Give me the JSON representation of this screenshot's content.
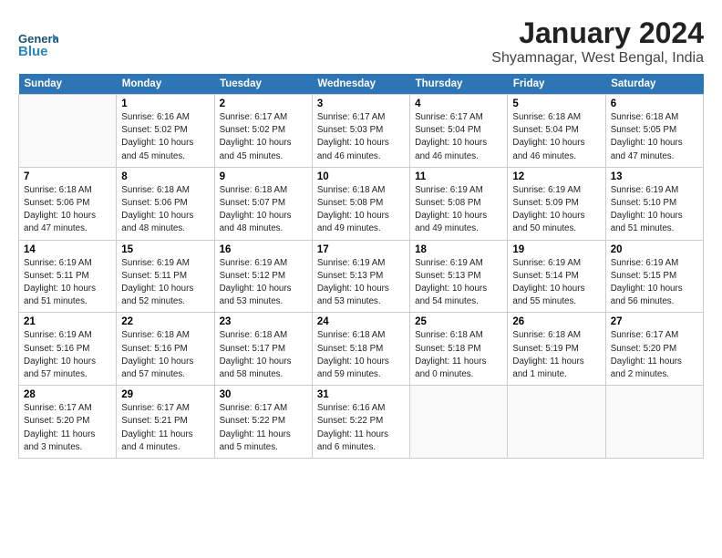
{
  "logo": {
    "general": "General",
    "blue": "Blue"
  },
  "title": "January 2024",
  "subtitle": "Shyamnagar, West Bengal, India",
  "days_header": [
    "Sunday",
    "Monday",
    "Tuesday",
    "Wednesday",
    "Thursday",
    "Friday",
    "Saturday"
  ],
  "weeks": [
    [
      {
        "num": "",
        "info": ""
      },
      {
        "num": "1",
        "info": "Sunrise: 6:16 AM\nSunset: 5:02 PM\nDaylight: 10 hours\nand 45 minutes."
      },
      {
        "num": "2",
        "info": "Sunrise: 6:17 AM\nSunset: 5:02 PM\nDaylight: 10 hours\nand 45 minutes."
      },
      {
        "num": "3",
        "info": "Sunrise: 6:17 AM\nSunset: 5:03 PM\nDaylight: 10 hours\nand 46 minutes."
      },
      {
        "num": "4",
        "info": "Sunrise: 6:17 AM\nSunset: 5:04 PM\nDaylight: 10 hours\nand 46 minutes."
      },
      {
        "num": "5",
        "info": "Sunrise: 6:18 AM\nSunset: 5:04 PM\nDaylight: 10 hours\nand 46 minutes."
      },
      {
        "num": "6",
        "info": "Sunrise: 6:18 AM\nSunset: 5:05 PM\nDaylight: 10 hours\nand 47 minutes."
      }
    ],
    [
      {
        "num": "7",
        "info": "Sunrise: 6:18 AM\nSunset: 5:06 PM\nDaylight: 10 hours\nand 47 minutes."
      },
      {
        "num": "8",
        "info": "Sunrise: 6:18 AM\nSunset: 5:06 PM\nDaylight: 10 hours\nand 48 minutes."
      },
      {
        "num": "9",
        "info": "Sunrise: 6:18 AM\nSunset: 5:07 PM\nDaylight: 10 hours\nand 48 minutes."
      },
      {
        "num": "10",
        "info": "Sunrise: 6:18 AM\nSunset: 5:08 PM\nDaylight: 10 hours\nand 49 minutes."
      },
      {
        "num": "11",
        "info": "Sunrise: 6:19 AM\nSunset: 5:08 PM\nDaylight: 10 hours\nand 49 minutes."
      },
      {
        "num": "12",
        "info": "Sunrise: 6:19 AM\nSunset: 5:09 PM\nDaylight: 10 hours\nand 50 minutes."
      },
      {
        "num": "13",
        "info": "Sunrise: 6:19 AM\nSunset: 5:10 PM\nDaylight: 10 hours\nand 51 minutes."
      }
    ],
    [
      {
        "num": "14",
        "info": "Sunrise: 6:19 AM\nSunset: 5:11 PM\nDaylight: 10 hours\nand 51 minutes."
      },
      {
        "num": "15",
        "info": "Sunrise: 6:19 AM\nSunset: 5:11 PM\nDaylight: 10 hours\nand 52 minutes."
      },
      {
        "num": "16",
        "info": "Sunrise: 6:19 AM\nSunset: 5:12 PM\nDaylight: 10 hours\nand 53 minutes."
      },
      {
        "num": "17",
        "info": "Sunrise: 6:19 AM\nSunset: 5:13 PM\nDaylight: 10 hours\nand 53 minutes."
      },
      {
        "num": "18",
        "info": "Sunrise: 6:19 AM\nSunset: 5:13 PM\nDaylight: 10 hours\nand 54 minutes."
      },
      {
        "num": "19",
        "info": "Sunrise: 6:19 AM\nSunset: 5:14 PM\nDaylight: 10 hours\nand 55 minutes."
      },
      {
        "num": "20",
        "info": "Sunrise: 6:19 AM\nSunset: 5:15 PM\nDaylight: 10 hours\nand 56 minutes."
      }
    ],
    [
      {
        "num": "21",
        "info": "Sunrise: 6:19 AM\nSunset: 5:16 PM\nDaylight: 10 hours\nand 57 minutes."
      },
      {
        "num": "22",
        "info": "Sunrise: 6:18 AM\nSunset: 5:16 PM\nDaylight: 10 hours\nand 57 minutes."
      },
      {
        "num": "23",
        "info": "Sunrise: 6:18 AM\nSunset: 5:17 PM\nDaylight: 10 hours\nand 58 minutes."
      },
      {
        "num": "24",
        "info": "Sunrise: 6:18 AM\nSunset: 5:18 PM\nDaylight: 10 hours\nand 59 minutes."
      },
      {
        "num": "25",
        "info": "Sunrise: 6:18 AM\nSunset: 5:18 PM\nDaylight: 11 hours\nand 0 minutes."
      },
      {
        "num": "26",
        "info": "Sunrise: 6:18 AM\nSunset: 5:19 PM\nDaylight: 11 hours\nand 1 minute."
      },
      {
        "num": "27",
        "info": "Sunrise: 6:17 AM\nSunset: 5:20 PM\nDaylight: 11 hours\nand 2 minutes."
      }
    ],
    [
      {
        "num": "28",
        "info": "Sunrise: 6:17 AM\nSunset: 5:20 PM\nDaylight: 11 hours\nand 3 minutes."
      },
      {
        "num": "29",
        "info": "Sunrise: 6:17 AM\nSunset: 5:21 PM\nDaylight: 11 hours\nand 4 minutes."
      },
      {
        "num": "30",
        "info": "Sunrise: 6:17 AM\nSunset: 5:22 PM\nDaylight: 11 hours\nand 5 minutes."
      },
      {
        "num": "31",
        "info": "Sunrise: 6:16 AM\nSunset: 5:22 PM\nDaylight: 11 hours\nand 6 minutes."
      },
      {
        "num": "",
        "info": ""
      },
      {
        "num": "",
        "info": ""
      },
      {
        "num": "",
        "info": ""
      }
    ]
  ]
}
